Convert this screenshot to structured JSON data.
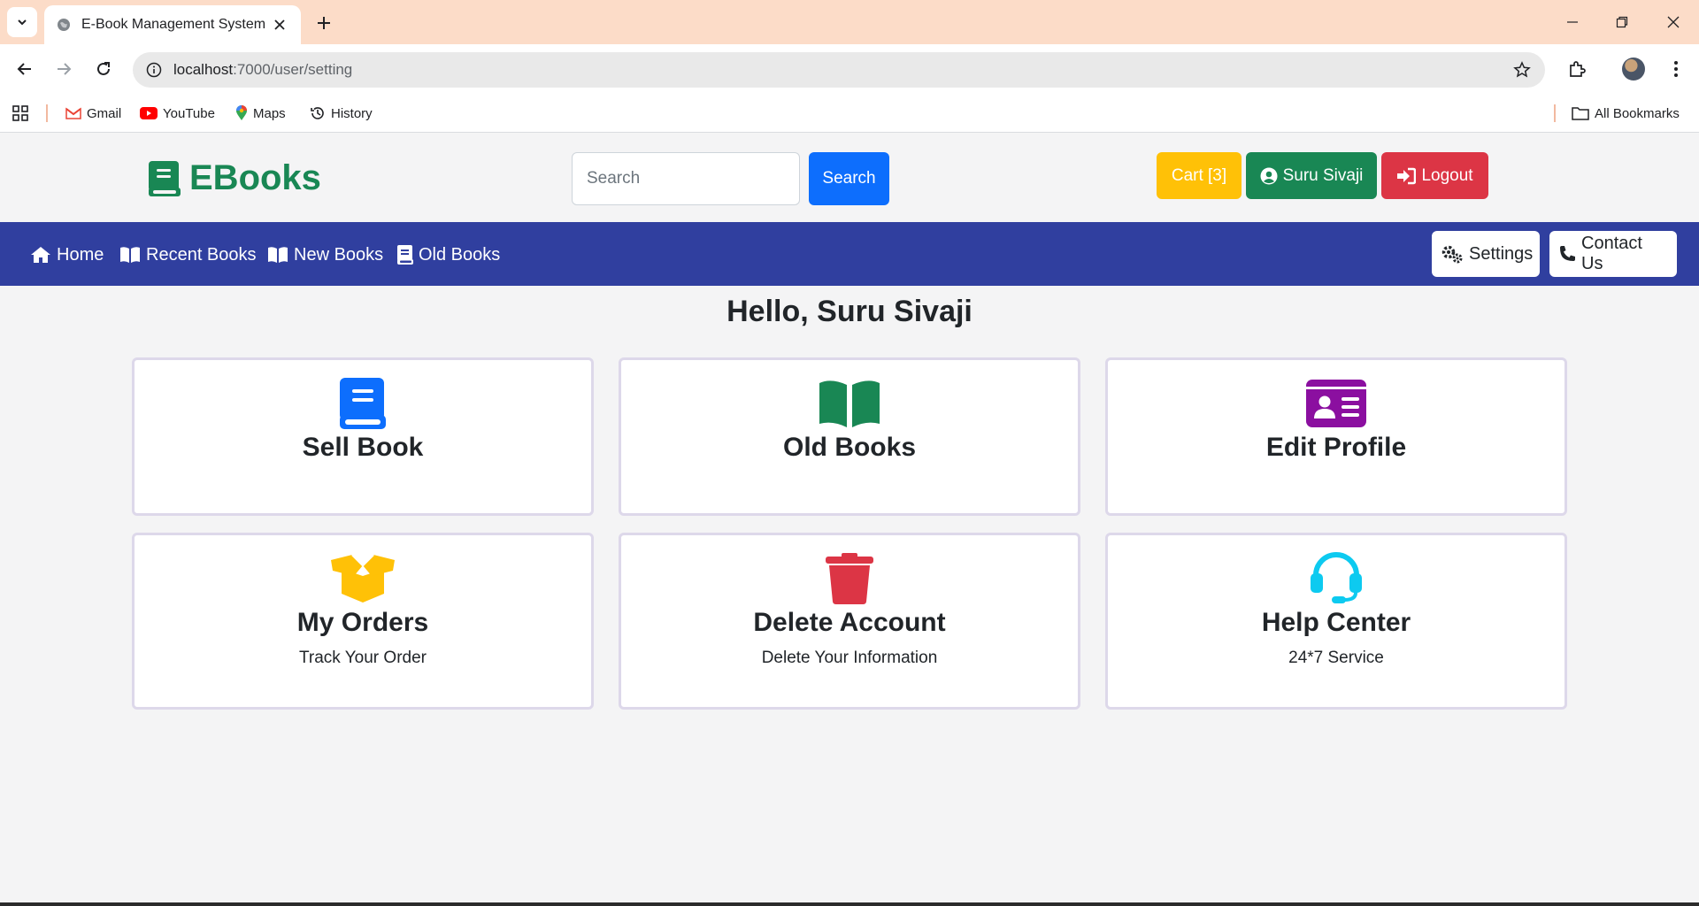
{
  "browser": {
    "tab_title": "E-Book Management System",
    "url_host": "localhost",
    "url_path": ":7000/user/setting",
    "bookmarks": [
      "Gmail",
      "YouTube",
      "Maps",
      "History"
    ],
    "all_bookmarks": "All Bookmarks"
  },
  "header": {
    "logo_text": "EBooks",
    "search_placeholder": "Search",
    "search_label": "Search",
    "cart_label": "Cart [3]",
    "user_label": "Suru Sivaji",
    "logout_label": "Logout"
  },
  "nav": {
    "home": "Home",
    "recent": "Recent Books",
    "new": "New Books",
    "old": "Old Books",
    "settings": "Settings",
    "contact": "Contact Us"
  },
  "main": {
    "greeting": "Hello, Suru Sivaji",
    "cards": [
      {
        "title": "Sell Book",
        "subtitle": "",
        "icon": "book-icon",
        "color": "#0d6efd"
      },
      {
        "title": "Old Books",
        "subtitle": "",
        "icon": "open-book-icon",
        "color": "#198754"
      },
      {
        "title": "Edit Profile",
        "subtitle": "",
        "icon": "id-card-icon",
        "color": "#8b0fa0"
      },
      {
        "title": "My Orders",
        "subtitle": "Track Your Order",
        "icon": "box-open-icon",
        "color": "#ffc107"
      },
      {
        "title": "Delete Account",
        "subtitle": "Delete Your Information",
        "icon": "trash-icon",
        "color": "#dc3545"
      },
      {
        "title": "Help Center",
        "subtitle": "24*7 Service",
        "icon": "headset-icon",
        "color": "#0dcaf0"
      }
    ]
  },
  "colors": {
    "brand": "#198754",
    "navbar": "#303f9f",
    "primary": "#0d6efd",
    "warning": "#ffc107",
    "success": "#198754",
    "danger": "#dc3545"
  }
}
